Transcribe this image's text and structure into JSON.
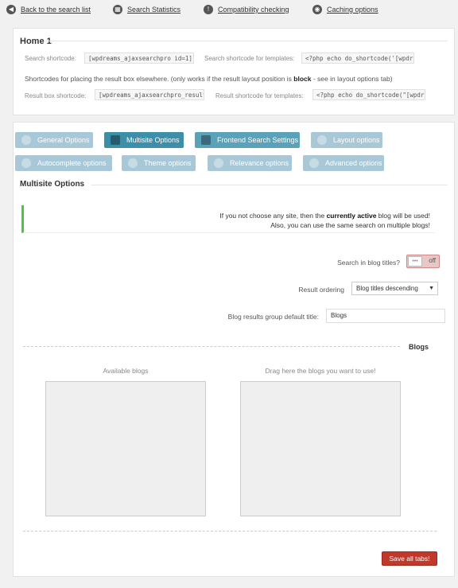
{
  "nav": {
    "back": "Back to the search list",
    "stats": "Search Statistics",
    "compat": "Compatibility checking",
    "caching": "Caching options"
  },
  "home": {
    "title": "Home 1",
    "search_shortcode_label": "Search shortcode:",
    "search_shortcode_value": "[wpdreams_ajaxsearchpro id=1]",
    "template_label": "Search shortcode for templates:",
    "template_value": "<?php echo do_shortcode('[wpdre",
    "result_desc_pre": "Shortcodes for placing the result box elsewhere. (only works if the result layout position is ",
    "result_desc_bold": "block",
    "result_desc_post": " - see in layout options tab)",
    "result_box_label": "Result box shortcode:",
    "result_box_value": "[wpdreams_ajaxsearchpro_results",
    "result_template_label": "Result shortcode for templates:",
    "result_template_value": "<?php echo do_shortcode(\"[wpdre"
  },
  "tabs": {
    "general": "General Options",
    "multisite": "Multisite Options",
    "frontend": "Frontend Search Settings",
    "layout": "Layout options",
    "autocomplete": "Autocomplete options",
    "theme": "Theme options",
    "relevance": "Relevance options",
    "advanced": "Advanced options"
  },
  "multisite": {
    "title": "Multisite Options",
    "notice_pre": "If you not choose any site, then the ",
    "notice_bold": "currently active",
    "notice_post": " blog will be used!",
    "notice_line2": "Also, you can use the same search on multiple blogs!",
    "search_blog_titles_label": "Search in blog titles?",
    "toggle_state": "off",
    "result_ordering_label": "Result ordering",
    "result_ordering_value": "Blog titles descending",
    "group_title_label": "Blog results group default title:",
    "group_title_value": "Blogs",
    "blogs_heading": "Blogs",
    "available_title": "Available blogs",
    "drag_title": "Drag here the blogs you want to use!",
    "save_label": "Save all tabs!"
  },
  "colors": {
    "tab_inactive": "#a9c8d7",
    "tab_active": "#3d8ea8",
    "notice_border": "#4cc63e",
    "save_button": "#c0392b"
  }
}
